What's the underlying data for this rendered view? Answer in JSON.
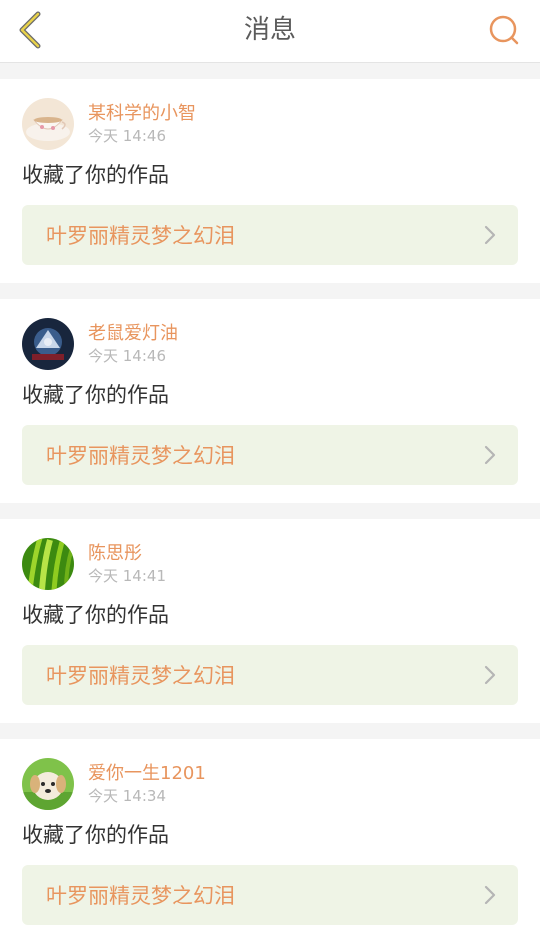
{
  "header": {
    "title": "消息",
    "back_icon": "chevron-left-icon",
    "search_icon": "search-icon",
    "accent_color": "#e8955e"
  },
  "notifications": [
    {
      "username": "某科学的小智",
      "time": "今天 14:46",
      "action": "收藏了你的作品",
      "work_title": "叶罗丽精灵梦之幻泪",
      "avatar_icon": "teacup-avatar"
    },
    {
      "username": "老鼠爱灯油",
      "time": "今天 14:46",
      "action": "收藏了你的作品",
      "work_title": "叶罗丽精灵梦之幻泪",
      "avatar_icon": "dark-poster-avatar"
    },
    {
      "username": "陈思彤",
      "time": "今天 14:41",
      "action": "收藏了你的作品",
      "work_title": "叶罗丽精灵梦之幻泪",
      "avatar_icon": "grass-avatar"
    },
    {
      "username": "爱你一生1201",
      "time": "今天 14:34",
      "action": "收藏了你的作品",
      "work_title": "叶罗丽精灵梦之幻泪",
      "avatar_icon": "puppy-avatar"
    }
  ]
}
